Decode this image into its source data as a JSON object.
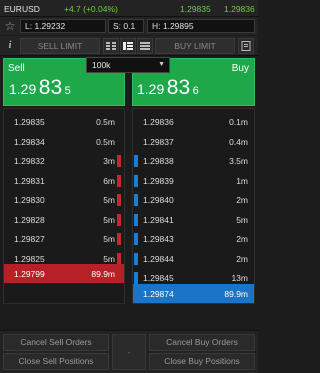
{
  "header": {
    "symbol": "EURUSD",
    "change": "+4.7 (+0.04%)",
    "bid_price": "1.29835",
    "ask_price": "1.29836"
  },
  "stats": {
    "low": "L: 1.29232",
    "spread": "S: 0.1",
    "high": "H: 1.29895"
  },
  "toolbar": {
    "info_label": "i",
    "sell_limit_label": "SELL LIMIT",
    "buy_limit_label": "BUY LIMIT"
  },
  "quantity": {
    "value": "100k"
  },
  "sell_panel": {
    "label": "Sell",
    "price_prefix": "1.29",
    "price_big": "83",
    "price_pip": "5"
  },
  "buy_panel": {
    "label": "Buy",
    "price_prefix": "1.29",
    "price_big": "83",
    "price_pip": "6"
  },
  "bid_book": [
    {
      "price": "1.29835",
      "volume": "0.5m",
      "depth": 0
    },
    {
      "price": "1.29834",
      "volume": "0.5m",
      "depth": 0
    },
    {
      "price": "1.29832",
      "volume": "3m",
      "depth": 1
    },
    {
      "price": "1.29831",
      "volume": "6m",
      "depth": 1
    },
    {
      "price": "1.29830",
      "volume": "5m",
      "depth": 1
    },
    {
      "price": "1.29828",
      "volume": "5m",
      "depth": 1
    },
    {
      "price": "1.29827",
      "volume": "5m",
      "depth": 1
    },
    {
      "price": "1.29825",
      "volume": "5m",
      "depth": 1
    },
    {
      "price": "1.29799",
      "volume": "89.9m",
      "depth": 0
    }
  ],
  "ask_book": [
    {
      "price": "1.29836",
      "volume": "0.1m",
      "depth": 0
    },
    {
      "price": "1.29837",
      "volume": "0.4m",
      "depth": 0
    },
    {
      "price": "1.29838",
      "volume": "3.5m",
      "depth": 1
    },
    {
      "price": "1.29839",
      "volume": "1m",
      "depth": 1
    },
    {
      "price": "1.29840",
      "volume": "2m",
      "depth": 1
    },
    {
      "price": "1.29841",
      "volume": "5m",
      "depth": 1
    },
    {
      "price": "1.29843",
      "volume": "2m",
      "depth": 1
    },
    {
      "price": "1.29844",
      "volume": "2m",
      "depth": 1
    },
    {
      "price": "1.29845",
      "volume": "13m",
      "depth": 1
    },
    {
      "price": "1.29874",
      "volume": "89.9m",
      "depth": 0
    }
  ],
  "actions": {
    "cancel_sell": "Cancel Sell Orders",
    "cancel_buy": "Cancel Buy Orders",
    "close_sell": "Close Sell Positions",
    "close_buy": "Close Buy Positions",
    "middle": "-"
  },
  "colors": {
    "green_panel": "#1fa84a",
    "bid_bar": "#c7262c",
    "ask_bar": "#1a7ed6",
    "uptick": "#6fcf3f"
  }
}
